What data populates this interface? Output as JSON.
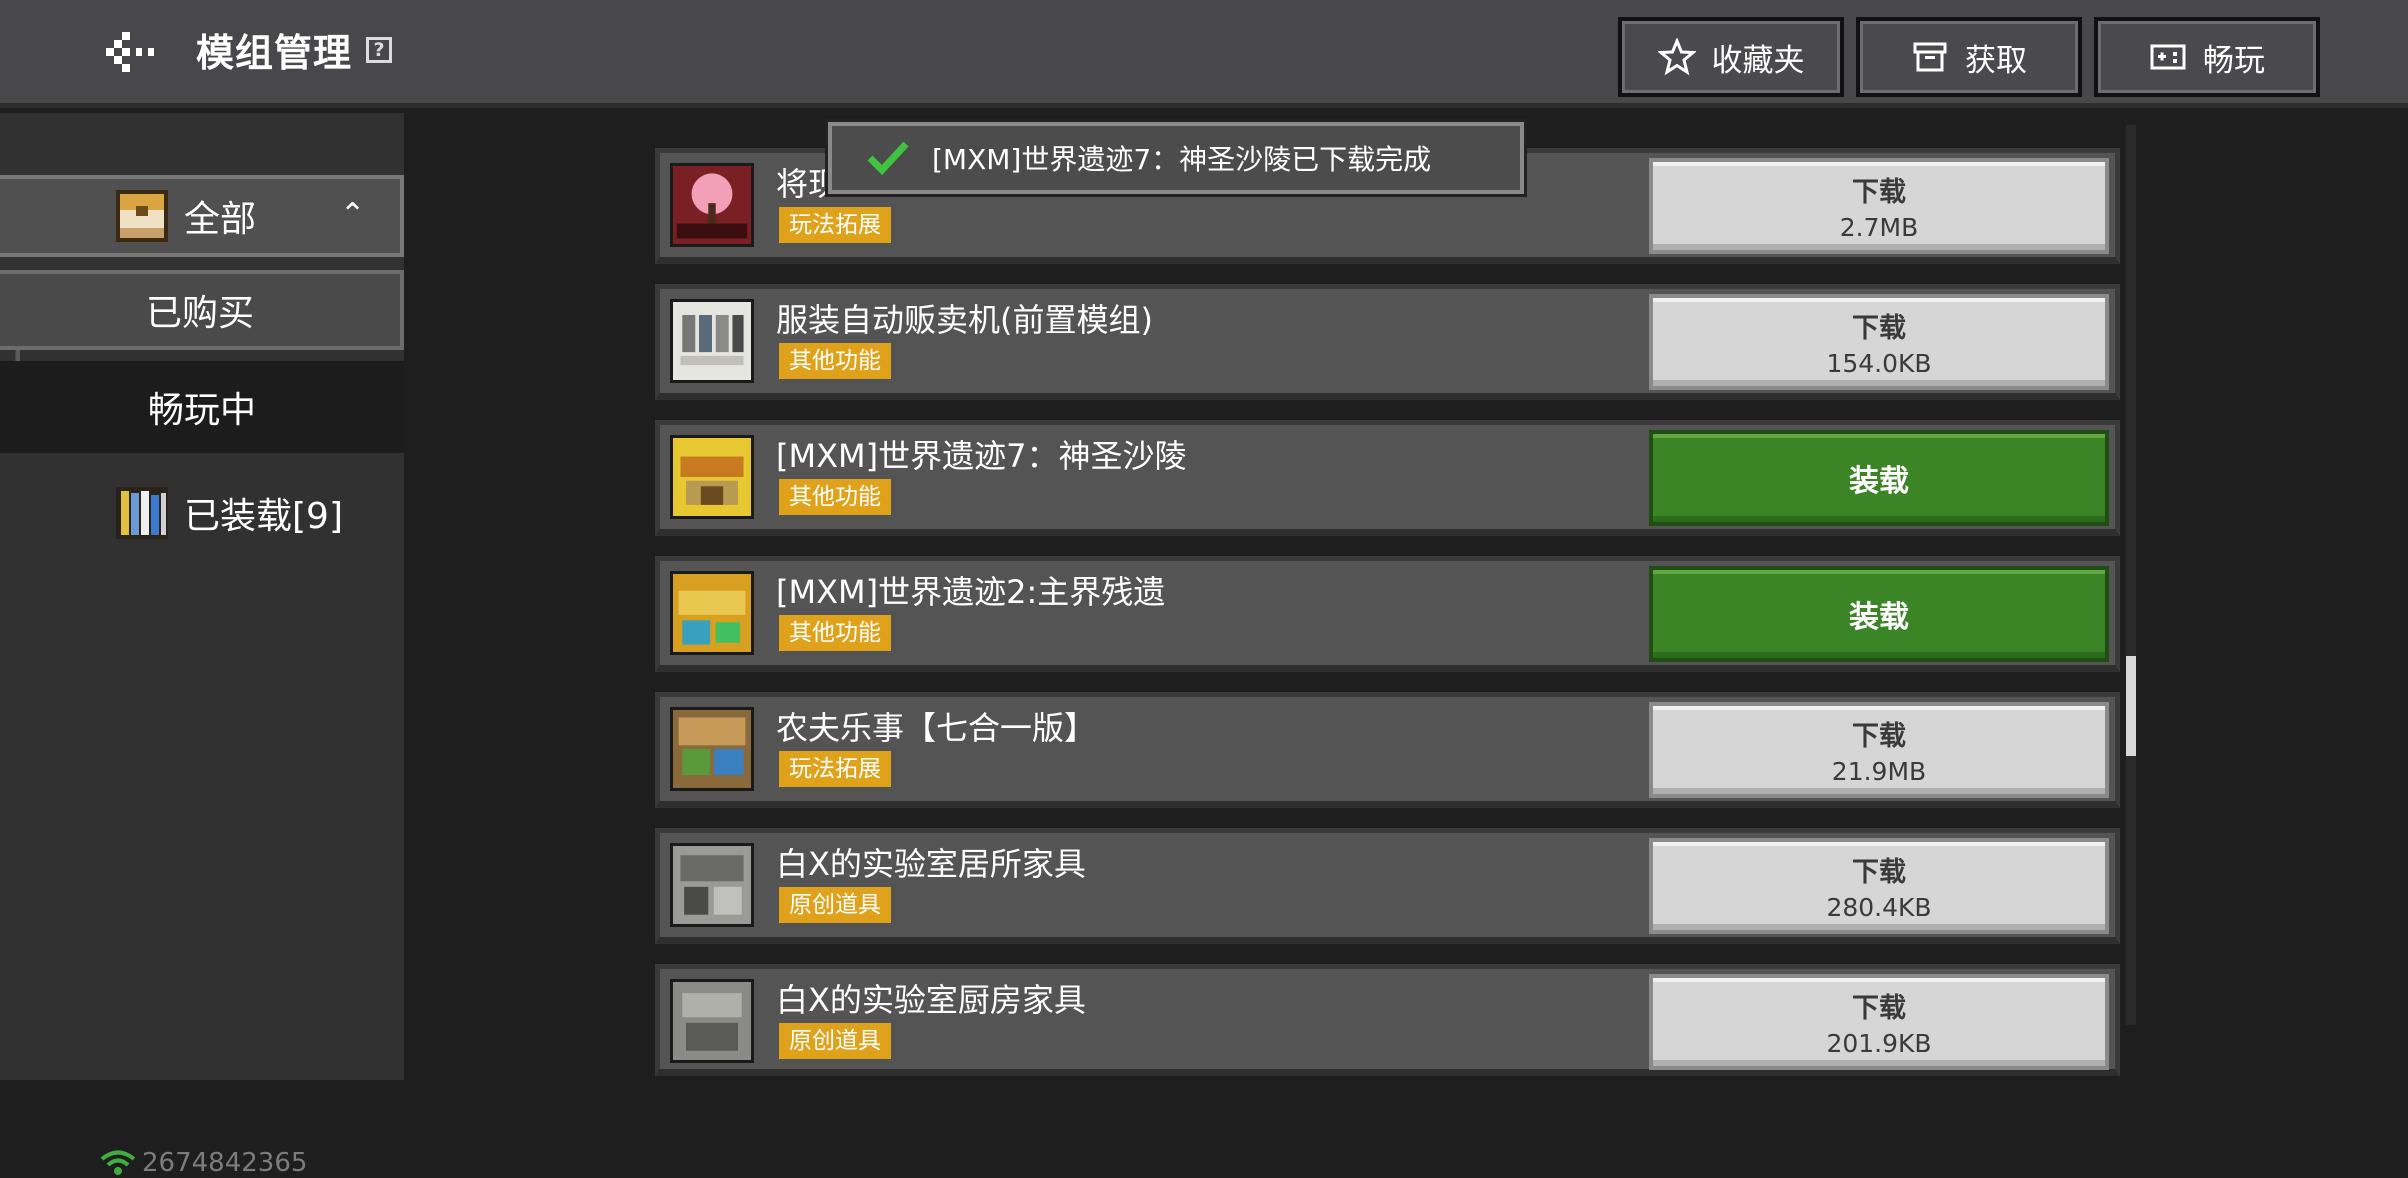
{
  "header": {
    "title": "模组管理",
    "help_glyph": "?",
    "buttons": [
      {
        "label": "收藏夹",
        "icon": "star-icon"
      },
      {
        "label": "获取",
        "icon": "chest-icon"
      },
      {
        "label": "畅玩",
        "icon": "gamepad-icon"
      }
    ]
  },
  "sidebar": {
    "all_label": "全部",
    "bought_label": "已购买",
    "playing_label": "畅玩中",
    "loaded_label": "已装载[9]",
    "network_id": "2674842365"
  },
  "toast": {
    "message": "[MXM]世界遗迹7：神圣沙陵已下载完成"
  },
  "mods": [
    {
      "name": "将现",
      "tag": "玩法拓展",
      "action": "下载",
      "size": "2.7MB"
    },
    {
      "name": "服装自动贩卖机(前置模组)",
      "tag": "其他功能",
      "action": "下载",
      "size": "154.0KB"
    },
    {
      "name": "[MXM]世界遗迹7：神圣沙陵",
      "tag": "其他功能",
      "action": "装载",
      "size": ""
    },
    {
      "name": "[MXM]世界遗迹2:主界残遗",
      "tag": "其他功能",
      "action": "装载",
      "size": ""
    },
    {
      "name": "农夫乐事【七合一版】",
      "tag": "玩法拓展",
      "action": "下载",
      "size": "21.9MB"
    },
    {
      "name": "白X的实验室居所家具",
      "tag": "原创道具",
      "action": "下载",
      "size": "280.4KB"
    },
    {
      "name": "白X的实验室厨房家具",
      "tag": "原创道具",
      "action": "下载",
      "size": "201.9KB"
    }
  ],
  "colors": {
    "download_bg": "#d6d6d6",
    "load_bg": "#3c8527",
    "tag_bg": "#e0a21a"
  }
}
